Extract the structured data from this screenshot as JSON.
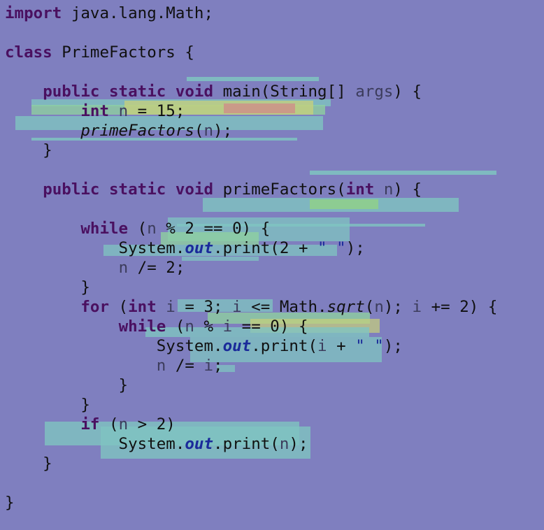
{
  "editor": {
    "background": "#7f7fbf",
    "colors": {
      "keyword": "#4a1060",
      "string": "#1a2a9a",
      "field": "#1a2a9a",
      "variable": "#3c3c5c",
      "text": "#101010"
    },
    "lines": [
      [
        {
          "c": "kw",
          "t": "import"
        },
        {
          "c": "plain",
          "t": " java.lang.Math;"
        }
      ],
      [],
      [
        {
          "c": "kw",
          "t": "class"
        },
        {
          "c": "plain",
          "t": " PrimeFactors {"
        }
      ],
      [],
      [
        {
          "c": "plain",
          "t": "    "
        },
        {
          "c": "kw",
          "t": "public"
        },
        {
          "c": "plain",
          "t": " "
        },
        {
          "c": "kw",
          "t": "static"
        },
        {
          "c": "plain",
          "t": " "
        },
        {
          "c": "kw",
          "t": "void"
        },
        {
          "c": "plain",
          "t": " main(String[] "
        },
        {
          "c": "var",
          "t": "args"
        },
        {
          "c": "plain",
          "t": ") {"
        }
      ],
      [
        {
          "c": "plain",
          "t": "        "
        },
        {
          "c": "kw",
          "t": "int"
        },
        {
          "c": "plain",
          "t": " "
        },
        {
          "c": "var",
          "t": "n"
        },
        {
          "c": "plain",
          "t": " = 15;"
        }
      ],
      [
        {
          "c": "plain",
          "t": "        "
        },
        {
          "c": "ital",
          "t": "primeFactors"
        },
        {
          "c": "plain",
          "t": "("
        },
        {
          "c": "var",
          "t": "n"
        },
        {
          "c": "plain",
          "t": ");"
        }
      ],
      [
        {
          "c": "plain",
          "t": "    }"
        }
      ],
      [],
      [
        {
          "c": "plain",
          "t": "    "
        },
        {
          "c": "kw",
          "t": "public"
        },
        {
          "c": "plain",
          "t": " "
        },
        {
          "c": "kw",
          "t": "static"
        },
        {
          "c": "plain",
          "t": " "
        },
        {
          "c": "kw",
          "t": "void"
        },
        {
          "c": "plain",
          "t": " primeFactors("
        },
        {
          "c": "kw",
          "t": "int"
        },
        {
          "c": "plain",
          "t": " "
        },
        {
          "c": "var",
          "t": "n"
        },
        {
          "c": "plain",
          "t": ") {"
        }
      ],
      [],
      [
        {
          "c": "plain",
          "t": "        "
        },
        {
          "c": "kw",
          "t": "while"
        },
        {
          "c": "plain",
          "t": " ("
        },
        {
          "c": "var",
          "t": "n"
        },
        {
          "c": "plain",
          "t": " % 2 == 0) {"
        }
      ],
      [
        {
          "c": "plain",
          "t": "            System."
        },
        {
          "c": "field",
          "t": "out"
        },
        {
          "c": "plain",
          "t": ".print(2 + "
        },
        {
          "c": "str",
          "t": "\" \""
        },
        {
          "c": "plain",
          "t": ");"
        }
      ],
      [
        {
          "c": "plain",
          "t": "            "
        },
        {
          "c": "var",
          "t": "n"
        },
        {
          "c": "plain",
          "t": " /= 2;"
        }
      ],
      [
        {
          "c": "plain",
          "t": "        }"
        }
      ],
      [
        {
          "c": "plain",
          "t": "        "
        },
        {
          "c": "kw",
          "t": "for"
        },
        {
          "c": "plain",
          "t": " ("
        },
        {
          "c": "kw",
          "t": "int"
        },
        {
          "c": "plain",
          "t": " "
        },
        {
          "c": "var",
          "t": "i"
        },
        {
          "c": "plain",
          "t": " = 3; "
        },
        {
          "c": "var",
          "t": "i"
        },
        {
          "c": "plain",
          "t": " <= Math."
        },
        {
          "c": "ital",
          "t": "sqrt"
        },
        {
          "c": "plain",
          "t": "("
        },
        {
          "c": "var",
          "t": "n"
        },
        {
          "c": "plain",
          "t": "); "
        },
        {
          "c": "var",
          "t": "i"
        },
        {
          "c": "plain",
          "t": " += 2) {"
        }
      ],
      [
        {
          "c": "plain",
          "t": "            "
        },
        {
          "c": "kw",
          "t": "while"
        },
        {
          "c": "plain",
          "t": " ("
        },
        {
          "c": "var",
          "t": "n"
        },
        {
          "c": "plain",
          "t": " % "
        },
        {
          "c": "var",
          "t": "i"
        },
        {
          "c": "plain",
          "t": " == 0) {"
        }
      ],
      [
        {
          "c": "plain",
          "t": "                System."
        },
        {
          "c": "field",
          "t": "out"
        },
        {
          "c": "plain",
          "t": ".print("
        },
        {
          "c": "var",
          "t": "i"
        },
        {
          "c": "plain",
          "t": " + "
        },
        {
          "c": "str",
          "t": "\" \""
        },
        {
          "c": "plain",
          "t": ");"
        }
      ],
      [
        {
          "c": "plain",
          "t": "                "
        },
        {
          "c": "var",
          "t": "n"
        },
        {
          "c": "plain",
          "t": " /= "
        },
        {
          "c": "var",
          "t": "i"
        },
        {
          "c": "plain",
          "t": ";"
        }
      ],
      [
        {
          "c": "plain",
          "t": "            }"
        }
      ],
      [
        {
          "c": "plain",
          "t": "        }"
        }
      ],
      [
        {
          "c": "plain",
          "t": "        "
        },
        {
          "c": "kw",
          "t": "if"
        },
        {
          "c": "plain",
          "t": " ("
        },
        {
          "c": "var",
          "t": "n"
        },
        {
          "c": "plain",
          "t": " > 2)"
        }
      ],
      [
        {
          "c": "plain",
          "t": "            System."
        },
        {
          "c": "field",
          "t": "out"
        },
        {
          "c": "plain",
          "t": ".print("
        },
        {
          "c": "var",
          "t": "n"
        },
        {
          "c": "plain",
          "t": ");"
        }
      ],
      [
        {
          "c": "plain",
          "t": "    }"
        }
      ],
      [],
      [
        {
          "c": "plain",
          "t": "}"
        }
      ]
    ]
  }
}
